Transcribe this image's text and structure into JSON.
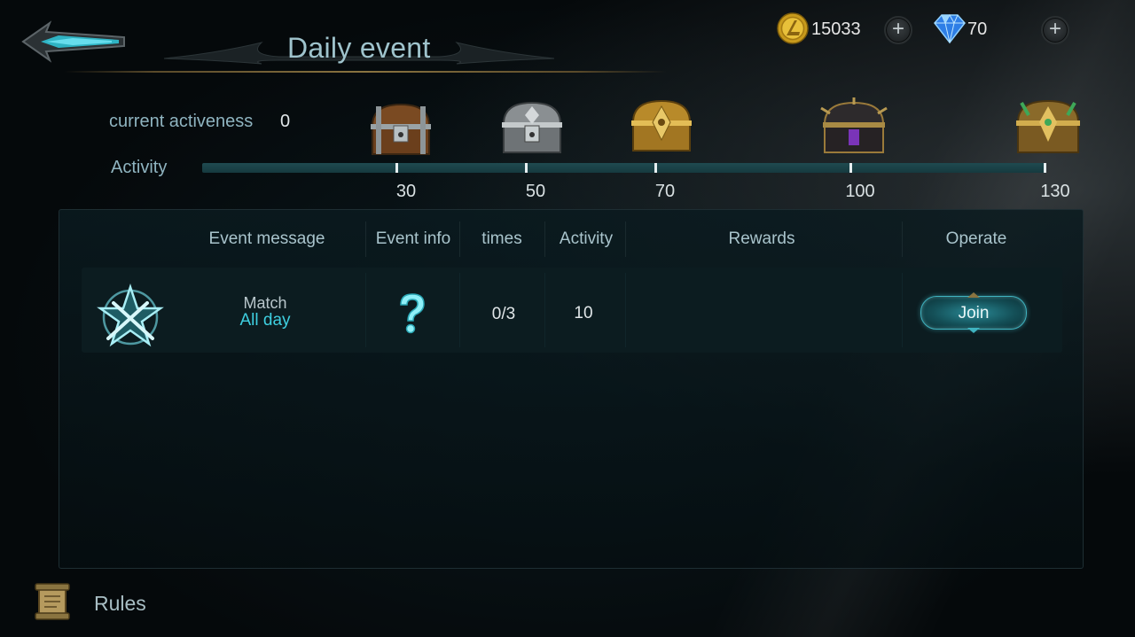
{
  "header": {
    "title": "Daily event",
    "back_icon": "back-arrow-icon",
    "currencies": [
      {
        "icon": "gold-coin-icon",
        "value": "15033",
        "add_label": "+"
      },
      {
        "icon": "diamond-icon",
        "value": "70",
        "add_label": "+"
      }
    ]
  },
  "activeness": {
    "current_label": "current activeness",
    "current_value": "0",
    "bar_label": "Activity",
    "progress_fraction": 0,
    "milestones": [
      {
        "value": "30",
        "chest_icon": "bronze-chest-icon"
      },
      {
        "value": "50",
        "chest_icon": "silver-chest-icon"
      },
      {
        "value": "70",
        "chest_icon": "gold-chest-icon"
      },
      {
        "value": "100",
        "chest_icon": "dark-chest-icon"
      },
      {
        "value": "130",
        "chest_icon": "jade-gold-chest-icon"
      }
    ]
  },
  "table": {
    "headers": [
      "Event message",
      "Event info",
      "times",
      "Activity",
      "Rewards",
      "Operate"
    ],
    "rows": [
      {
        "icon": "crossed-swords-star-icon",
        "name": "Match",
        "time": "All day",
        "info_icon": "question-mark-icon",
        "times": "0/3",
        "activity": "10",
        "rewards": "",
        "operate_label": "Join"
      }
    ]
  },
  "footer": {
    "rules_label": "Rules",
    "rules_icon": "rules-scroll-icon"
  },
  "colors": {
    "accent": "#3ecfe0",
    "track": "#1f4a50",
    "background": "#060a0c"
  }
}
